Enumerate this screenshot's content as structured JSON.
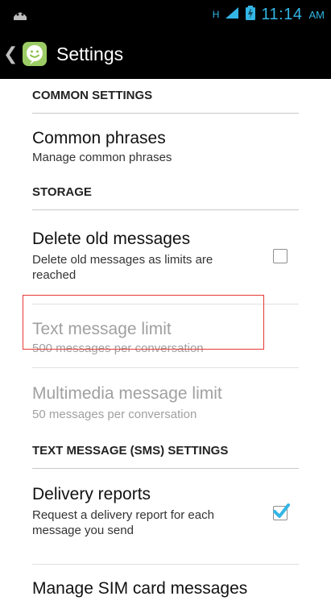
{
  "status_bar": {
    "time": "11:14",
    "ampm": "AM"
  },
  "action_bar": {
    "title": "Settings"
  },
  "sections": {
    "common": "COMMON SETTINGS",
    "storage": "STORAGE",
    "sms": "TEXT MESSAGE (SMS) SETTINGS"
  },
  "items": {
    "common_phrases": {
      "title": "Common phrases",
      "summary": "Manage common phrases"
    },
    "delete_old": {
      "title": "Delete old messages",
      "summary": "Delete old messages as limits are reached",
      "checked": false
    },
    "text_limit": {
      "title": "Text message limit",
      "summary": "500 messages per conversation"
    },
    "mms_limit": {
      "title": "Multimedia message limit",
      "summary": "50 messages per conversation"
    },
    "delivery_reports": {
      "title": "Delivery reports",
      "summary": "Request a delivery report for each message you send",
      "checked": true
    },
    "manage_sim": {
      "title": "Manage SIM card messages"
    }
  },
  "colors": {
    "accent": "#33b5e5",
    "highlight": "#e53935"
  }
}
